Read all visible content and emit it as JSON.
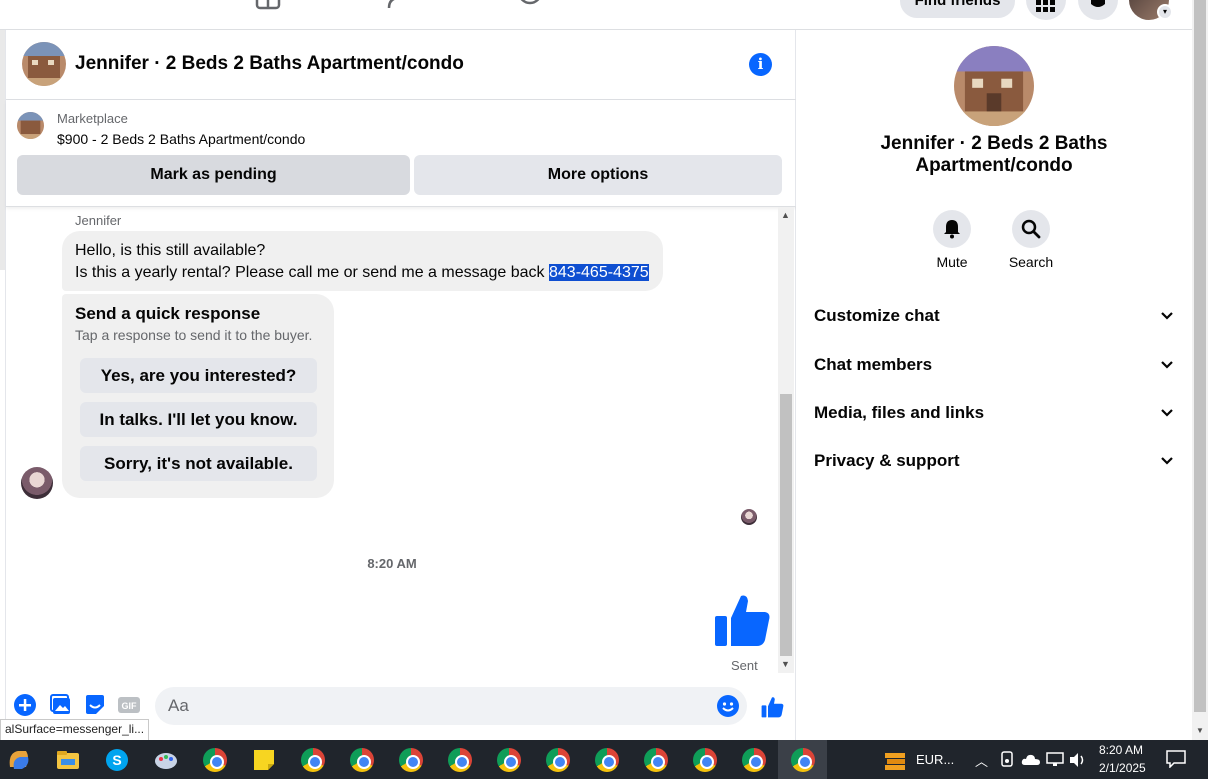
{
  "topbar": {
    "find_friends": "Find friends"
  },
  "chat": {
    "title": "Jennifer · 2 Beds 2 Baths Apartment/condo",
    "marketplace_label": "Marketplace",
    "listing": "$900 - 2 Beds 2 Baths Apartment/condo",
    "mark_pending": "Mark as pending",
    "more_options": "More options",
    "sender_name": "Jennifer",
    "message_line1": "Hello, is this still available?",
    "message_line2": "Is this a yearly rental? Please call me or send me a message back ",
    "message_phone": "843-465-4375",
    "quick_title": "Send a quick response",
    "quick_sub": "Tap a response to send it to the buyer.",
    "quick_responses": [
      "Yes, are you interested?",
      "In talks. I'll let you know.",
      "Sorry, it's not available."
    ],
    "time": "8:20 AM",
    "sent_label": "Sent",
    "composer_placeholder": "Aa",
    "status_url": "alSurface=messenger_li..."
  },
  "info": {
    "name": "Jennifer · 2 Beds 2 Baths Apartment/condo",
    "mute": "Mute",
    "search": "Search",
    "sections": [
      "Customize chat",
      "Chat members",
      "Media, files and links",
      "Privacy & support"
    ]
  },
  "taskbar": {
    "currency": "EUR...",
    "time": "8:20 AM",
    "date": "2/1/2025"
  },
  "colors": {
    "accent": "#0866ff",
    "selection": "#0f4fd1",
    "bubble": "#f0f0f0"
  }
}
